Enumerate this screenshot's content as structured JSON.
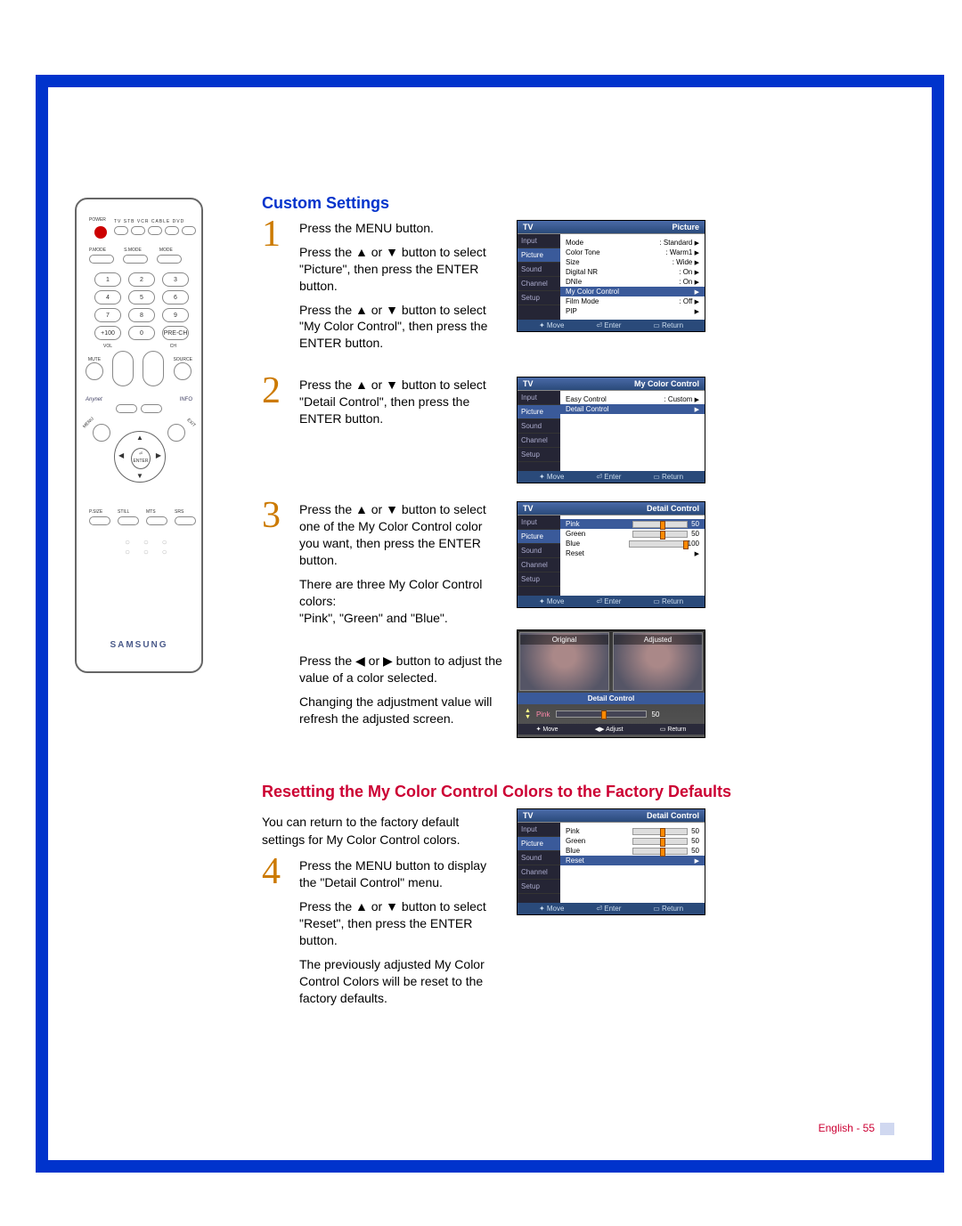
{
  "section1_title": "Custom Settings",
  "section2_title": "Resetting the My Color Control Colors to the Factory Defaults",
  "page_footer": "English - 55",
  "remote": {
    "brand": "SAMSUNG",
    "power_label": "POWER",
    "device_row": "TV  STB  VCR  CABLE  DVD",
    "pmode": "P.MODE",
    "smode": "S.MODE",
    "mode": "MODE",
    "nums": [
      "1",
      "2",
      "3",
      "4",
      "5",
      "6",
      "7",
      "8",
      "9",
      "+100",
      "0",
      "PRE-CH"
    ],
    "vol": "VOL",
    "ch": "CH",
    "mute": "MUTE",
    "source": "SOURCE",
    "anynet": "Anynet",
    "info": "INFO",
    "menu": "MENU",
    "exit": "EXIT",
    "enter": "ENTER",
    "bottom": [
      "P.SIZE",
      "STILL",
      "MTS",
      "SRS"
    ]
  },
  "steps": {
    "s1num": "1",
    "s1a": "Press the MENU button.",
    "s1b": "Press the ▲ or ▼ button to select \"Picture\", then press the ENTER button.",
    "s1c": "Press the ▲ or ▼ button to select \"My Color Control\", then press the ENTER button.",
    "s2num": "2",
    "s2": "Press the ▲ or ▼ button to select \"Detail Control\", then press the ENTER button.",
    "s3num": "3",
    "s3a": "Press the ▲ or ▼ button to select one of the My Color Control color you want, then press the ENTER button.",
    "s3b": "There are three My Color Control colors:",
    "s3c": "\"Pink\", \"Green\" and \"Blue\".",
    "s3d": "Press the ◀ or ▶ button to adjust the value of a color selected.",
    "s3e": "Changing the adjustment value will refresh the adjusted screen.",
    "intro2": "You can return to the factory default settings for My Color Control colors.",
    "s4num": "4",
    "s4a": "Press the MENU button to display the \"Detail Control\" menu.",
    "s4b": "Press the ▲ or ▼ button to select \"Reset\", then press the ENTER button.",
    "s4c": "The previously adjusted My Color Control Colors will be reset to the factory defaults."
  },
  "osd_nav": {
    "input": "Input",
    "picture": "Picture",
    "sound": "Sound",
    "channel": "Channel",
    "setup": "Setup",
    "tv": "TV"
  },
  "osd_footer": {
    "move": "Move",
    "enter": "Enter",
    "return": "Return",
    "adjust": "Adjust"
  },
  "osd1": {
    "title": "Picture",
    "rows": [
      {
        "l": "Mode",
        "v": ": Standard"
      },
      {
        "l": "Color Tone",
        "v": ": Warm1"
      },
      {
        "l": "Size",
        "v": ": Wide"
      },
      {
        "l": "Digital NR",
        "v": ": On"
      },
      {
        "l": "DNIe",
        "v": ": On"
      },
      {
        "l": "My Color Control",
        "v": "",
        "hl": true
      },
      {
        "l": "Film Mode",
        "v": ": Off"
      },
      {
        "l": "PIP",
        "v": ""
      }
    ]
  },
  "osd2": {
    "title": "My Color Control",
    "rows": [
      {
        "l": "Easy Control",
        "v": ": Custom"
      },
      {
        "l": "Detail Control",
        "v": "",
        "hl": true
      }
    ]
  },
  "osd3": {
    "title": "Detail Control",
    "rows": [
      {
        "l": "Pink",
        "v": "50",
        "hl": true,
        "pos": 50
      },
      {
        "l": "Green",
        "v": "50",
        "pos": 50
      },
      {
        "l": "Blue",
        "v": "100",
        "pos": 100
      },
      {
        "l": "Reset",
        "v": ""
      }
    ]
  },
  "osd4": {
    "title": "Detail Control",
    "original": "Original",
    "adjusted": "Adjusted",
    "color": "Pink",
    "value": "50"
  },
  "osd5": {
    "title": "Detail Control",
    "rows": [
      {
        "l": "Pink",
        "v": "50",
        "pos": 50
      },
      {
        "l": "Green",
        "v": "50",
        "pos": 50
      },
      {
        "l": "Blue",
        "v": "50",
        "pos": 50
      },
      {
        "l": "Reset",
        "v": "",
        "hl": true
      }
    ]
  }
}
